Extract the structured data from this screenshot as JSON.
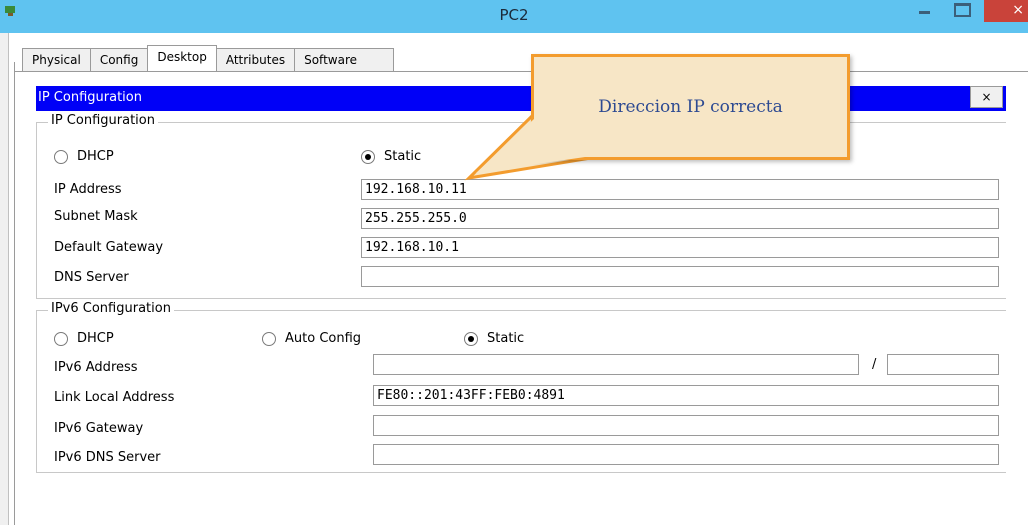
{
  "window": {
    "title": "PC2",
    "close_glyph": "×"
  },
  "tabs": [
    "Physical",
    "Config",
    "Desktop",
    "Attributes",
    "Software"
  ],
  "active_tab": "Desktop",
  "dialog": {
    "title": "IP Configuration",
    "close_glyph": "×",
    "ipv4": {
      "group_title": "IP Configuration",
      "dhcp_label": "DHCP",
      "static_label": "Static",
      "selected": "Static",
      "ip_address_label": "IP Address",
      "ip_address": "192.168.10.11",
      "subnet_mask_label": "Subnet Mask",
      "subnet_mask": "255.255.255.0",
      "gateway_label": "Default Gateway",
      "gateway": "192.168.10.1",
      "dns_label": "DNS Server",
      "dns": ""
    },
    "ipv6": {
      "group_title": "IPv6 Configuration",
      "dhcp_label": "DHCP",
      "auto_label": "Auto Config",
      "static_label": "Static",
      "selected": "Static",
      "address_label": "IPv6 Address",
      "address": "",
      "prefix_sep": "/",
      "prefix": "",
      "link_local_label": "Link Local Address",
      "link_local": "FE80::201:43FF:FEB0:4891",
      "gateway_label": "IPv6 Gateway",
      "gateway": "",
      "dns_label": "IPv6 DNS Server",
      "dns": ""
    }
  },
  "callout": {
    "text": "Direccion IP correcta"
  },
  "colors": {
    "titlebar": "#5fc3f0",
    "dialog_titlebar": "#0000f7",
    "callout_border": "#f39c2e",
    "callout_fill": "#f7e6c6",
    "callout_text": "#2d4a92"
  }
}
